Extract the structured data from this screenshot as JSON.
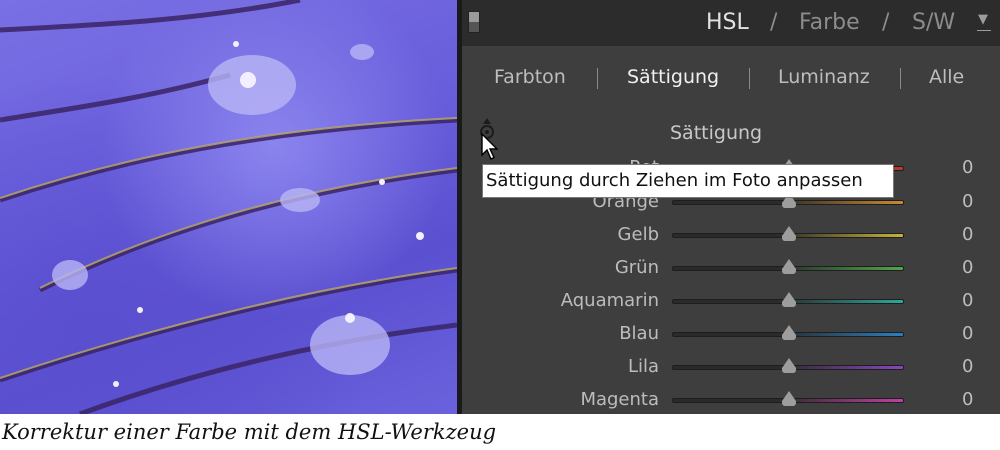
{
  "panel_header": {
    "tabs": [
      "HSL",
      "Farbe",
      "S/W"
    ],
    "separator": "/",
    "active": "HSL"
  },
  "sub_tabs": {
    "items": [
      "Farbton",
      "Sättigung",
      "Luminanz",
      "Alle"
    ],
    "active": "Sättigung"
  },
  "section_title": "Sättigung",
  "tooltip": "Sättigung durch Ziehen im Foto anpassen",
  "sliders": [
    {
      "label": "Rot",
      "value": "0",
      "color": "#c0392b"
    },
    {
      "label": "Orange",
      "value": "0",
      "color": "#c98a2e"
    },
    {
      "label": "Gelb",
      "value": "0",
      "color": "#c7b23a"
    },
    {
      "label": "Grün",
      "value": "0",
      "color": "#4fa84a"
    },
    {
      "label": "Aquamarin",
      "value": "0",
      "color": "#2fa79a"
    },
    {
      "label": "Blau",
      "value": "0",
      "color": "#2a7fc0"
    },
    {
      "label": "Lila",
      "value": "0",
      "color": "#8a45c0"
    },
    {
      "label": "Magenta",
      "value": "0",
      "color": "#c23fa6"
    }
  ],
  "caption": "Korrektur einer Farbe mit dem HSL-Werkzeug",
  "icons": {
    "panel_toggle": "panel-toggle-icon",
    "target_adjust": "target-adjustment-icon",
    "cursor": "mouse-pointer-icon",
    "header_arrow": "triangle-down-icon"
  }
}
